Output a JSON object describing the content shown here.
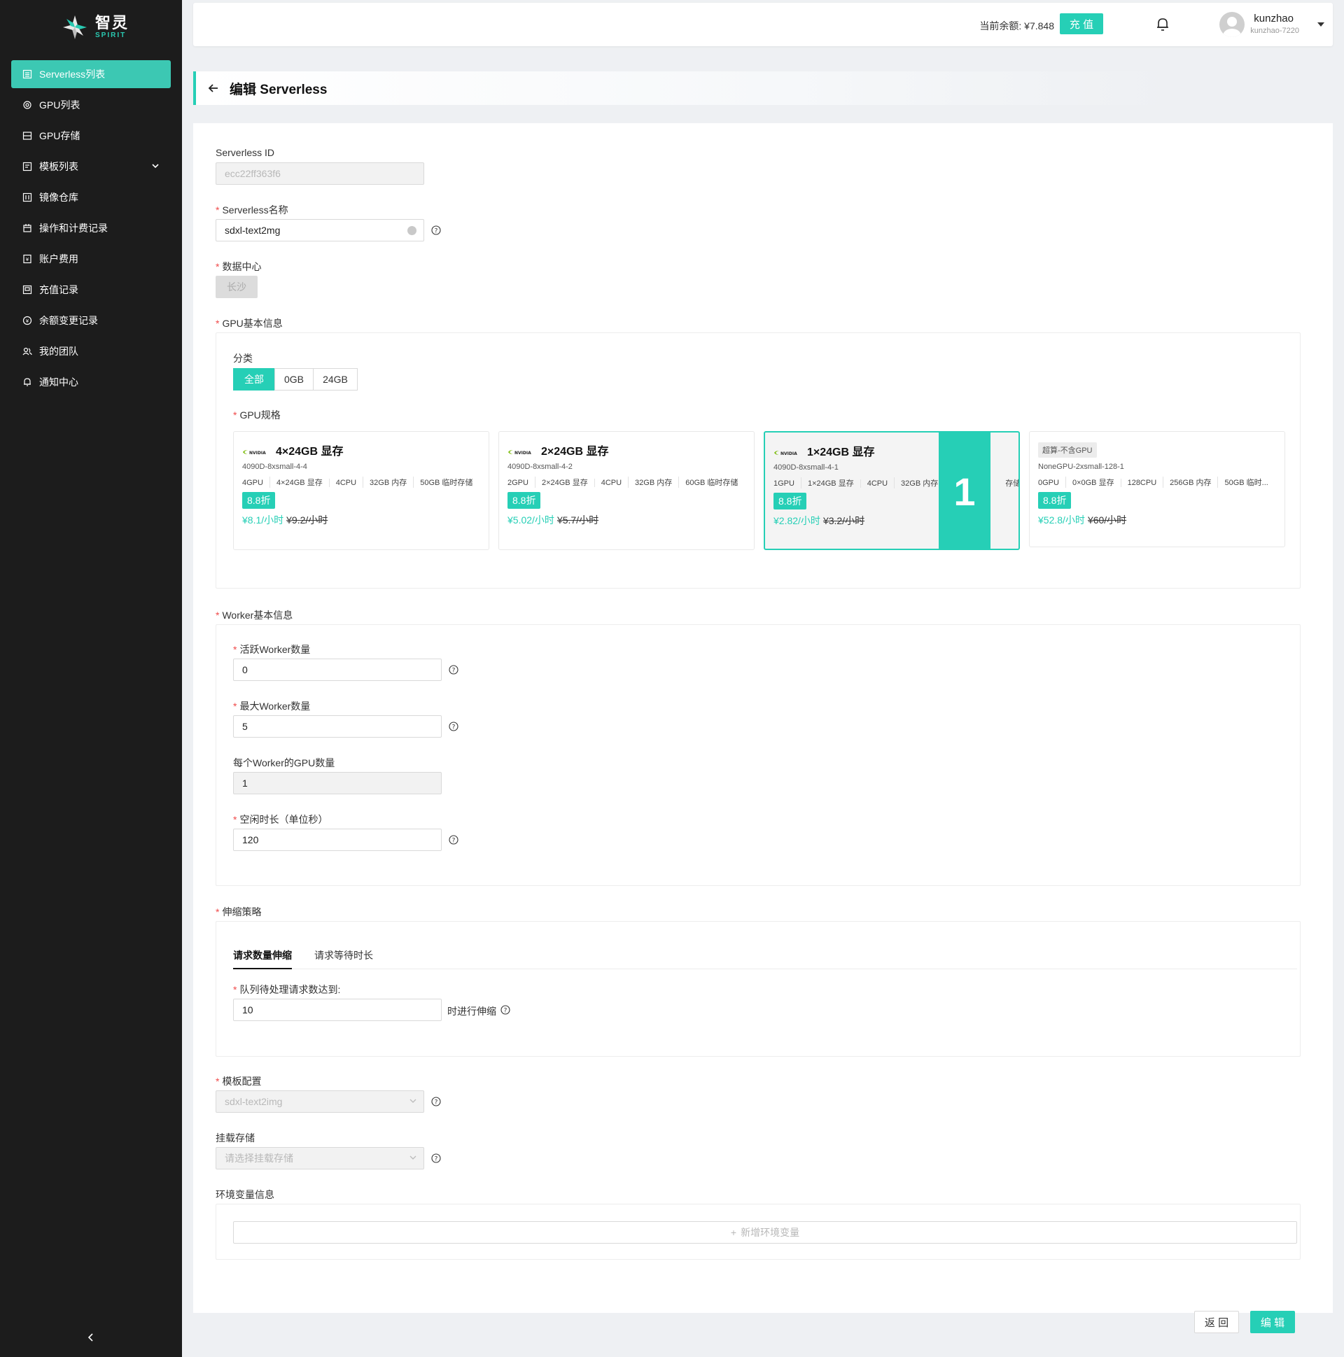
{
  "brand": {
    "name_cn": "智灵",
    "name_en": "SPIRIT"
  },
  "sidebar": {
    "items": [
      {
        "label": "Serverless列表",
        "icon": "list-icon",
        "active": true
      },
      {
        "label": "GPU列表",
        "icon": "gpu-icon"
      },
      {
        "label": "GPU存储",
        "icon": "storage-icon"
      },
      {
        "label": "模板列表",
        "icon": "template-icon",
        "expandable": true
      },
      {
        "label": "镜像仓库",
        "icon": "image-repo-icon"
      },
      {
        "label": "操作和计费记录",
        "icon": "billing-record-icon"
      },
      {
        "label": "账户费用",
        "icon": "account-fee-icon"
      },
      {
        "label": "充值记录",
        "icon": "recharge-record-icon"
      },
      {
        "label": "余额变更记录",
        "icon": "balance-change-icon"
      },
      {
        "label": "我的团队",
        "icon": "team-icon"
      },
      {
        "label": "通知中心",
        "icon": "notification-icon"
      }
    ]
  },
  "header": {
    "balance": "当前余额: ¥7.848",
    "recharge_label": "充 值",
    "user_name": "kunzhao",
    "user_sub": "kunzhao-7220"
  },
  "page": {
    "title": "编辑 Serverless"
  },
  "form": {
    "id_label": "Serverless ID",
    "id_value": "ecc22ff363f6",
    "name_label": "Serverless名称",
    "name_value": "sdxl-text2mg",
    "dc_label": "数据中心",
    "dc_value": "长沙",
    "gpu_section_label": "GPU基本信息",
    "category_label": "分类",
    "categories": [
      "全部",
      "0GB",
      "24GB"
    ],
    "gpu_spec_label": "GPU规格",
    "gpu_cards": [
      {
        "title": "4×24GB 显存",
        "code": "4090D-8xsmall-4-4",
        "specs": [
          "4GPU",
          "4×24GB 显存",
          "4CPU",
          "32GB 内存",
          "50GB 临时存储"
        ],
        "discount": "8.8折",
        "price": "¥8.1/小时",
        "old_price": "¥9.2/小时"
      },
      {
        "title": "2×24GB 显存",
        "code": "4090D-8xsmall-4-2",
        "specs": [
          "2GPU",
          "2×24GB 显存",
          "4CPU",
          "32GB 内存",
          "60GB 临时存储"
        ],
        "discount": "8.8折",
        "price": "¥5.02/小时",
        "old_price": "¥5.7/小时"
      },
      {
        "title": "1×24GB 显存",
        "code": "4090D-8xsmall-4-1",
        "specs": [
          "1GPU",
          "1×24GB 显存",
          "4CPU",
          "32GB 内存",
          "存储"
        ],
        "discount": "8.8折",
        "price": "¥2.82/小时",
        "old_price": "¥3.2/小时",
        "selected": true,
        "overlay": "1"
      },
      {
        "tag": "超算-不含GPU",
        "code": "NoneGPU-2xsmall-128-1",
        "specs": [
          "0GPU",
          "0×0GB 显存",
          "128CPU",
          "256GB 内存",
          "50GB 临时..."
        ],
        "discount": "8.8折",
        "price": "¥52.8/小时",
        "old_price": "¥60/小时"
      }
    ],
    "worker_section_label": "Worker基本信息",
    "active_worker_label": "活跃Worker数量",
    "active_worker_value": "0",
    "max_worker_label": "最大Worker数量",
    "max_worker_value": "5",
    "gpu_per_worker_label": "每个Worker的GPU数量",
    "gpu_per_worker_value": "1",
    "idle_label": "空闲时长（单位秒）",
    "idle_value": "120",
    "scale_section_label": "伸缩策略",
    "scale_tabs": [
      "请求数量伸缩",
      "请求等待时长"
    ],
    "queue_label": "队列待处理请求数达到:",
    "queue_value": "10",
    "queue_suffix": "时进行伸缩",
    "template_label": "模板配置",
    "template_value": "sdxl-text2img",
    "mount_label": "挂载存储",
    "mount_placeholder": "请选择挂载存储",
    "env_label": "环境变量信息",
    "add_env_label": "新增环境变量"
  },
  "footer": {
    "back_label": "返 回",
    "edit_label": "编 辑"
  },
  "colors": {
    "accent": "#26cfb6",
    "sidebar_bg": "#1c1c1c",
    "required": "#f04a4a"
  }
}
